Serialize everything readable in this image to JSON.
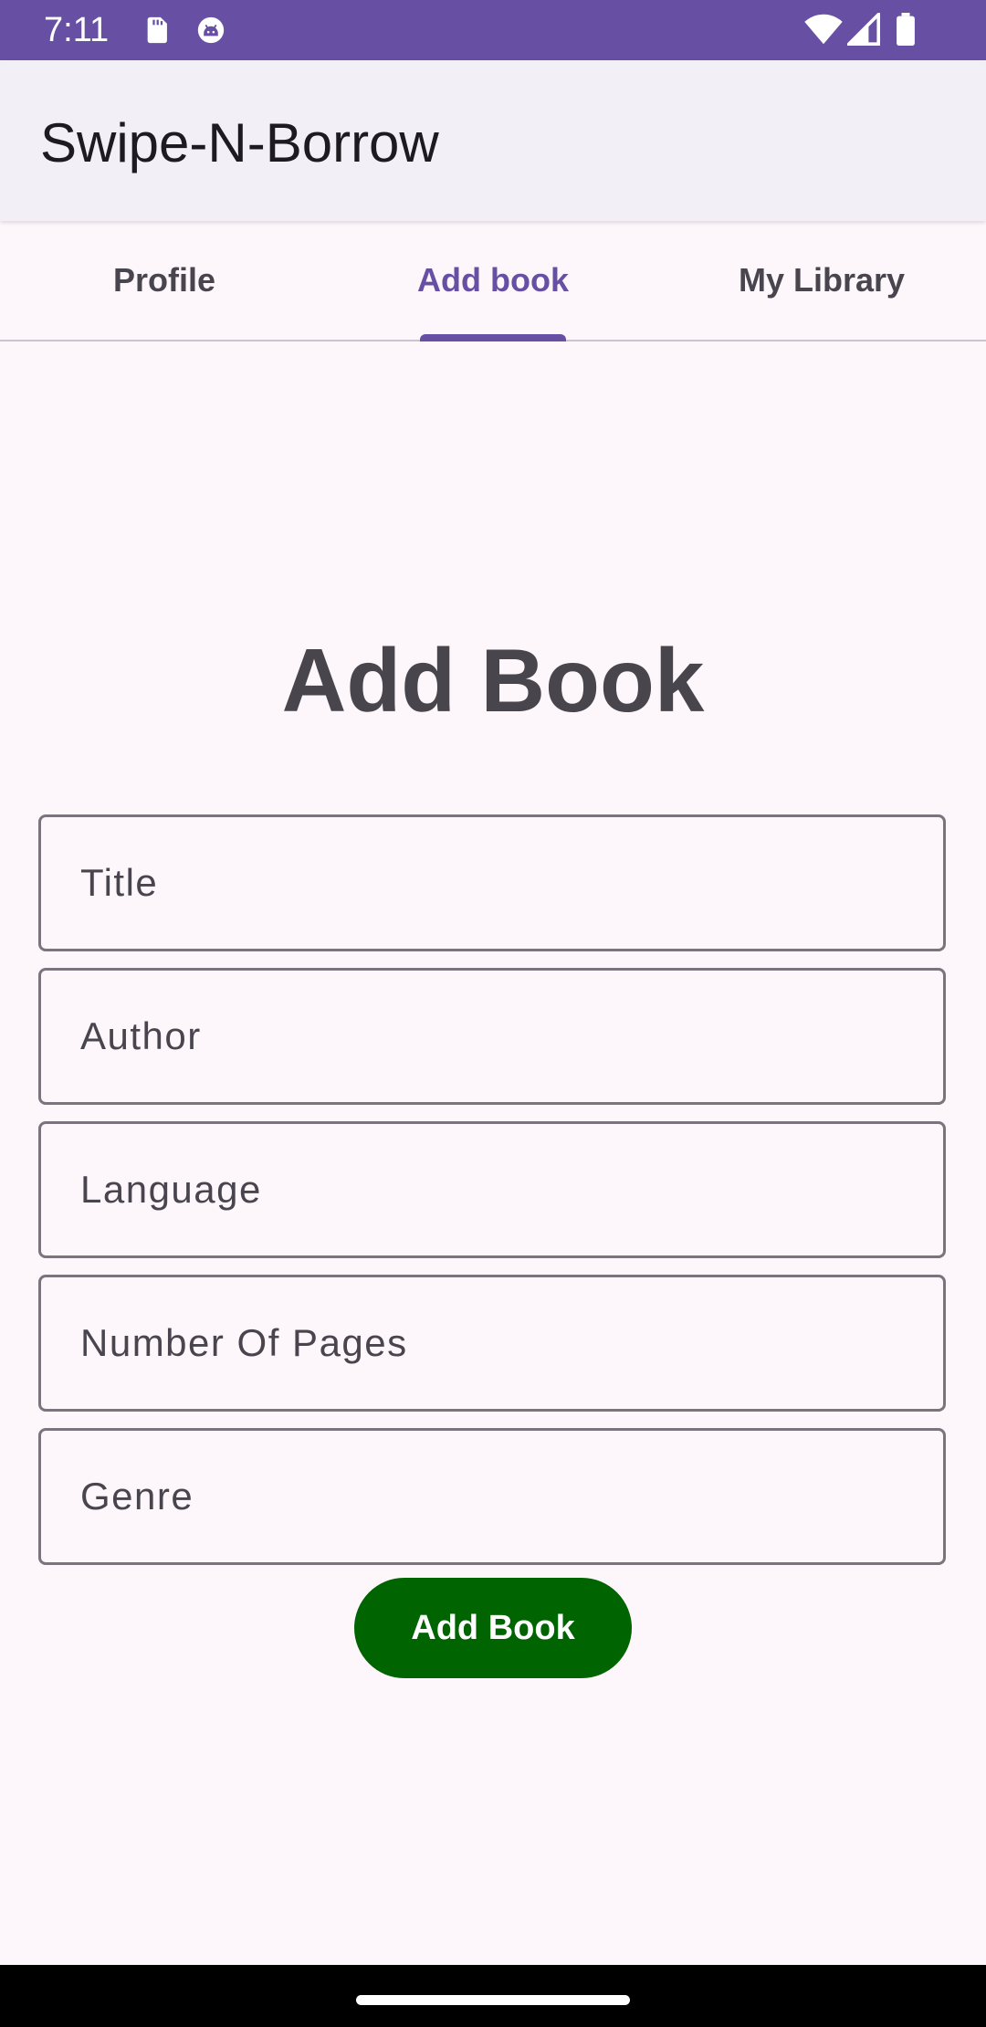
{
  "status_bar": {
    "time": "7:11",
    "left_icons": [
      "sd-card-icon",
      "android-debug-icon"
    ],
    "right_icons": [
      "wifi-icon",
      "signal-icon",
      "battery-icon"
    ],
    "color": "#6750A4"
  },
  "app_bar": {
    "title": "Swipe-N-Borrow"
  },
  "tabs": [
    {
      "label": "Profile",
      "active": false
    },
    {
      "label": "Add book",
      "active": true
    },
    {
      "label": "My Library",
      "active": false
    }
  ],
  "form": {
    "heading": "Add Book",
    "fields": {
      "title": {
        "placeholder": "Title",
        "value": ""
      },
      "author": {
        "placeholder": "Author",
        "value": ""
      },
      "language": {
        "placeholder": "Language",
        "value": ""
      },
      "pages": {
        "placeholder": "Number Of Pages",
        "value": ""
      },
      "genre": {
        "placeholder": "Genre",
        "value": ""
      }
    },
    "submit_label": "Add Book"
  },
  "colors": {
    "accent": "#6750A4",
    "button": "#006400",
    "background": "#FDF7FC"
  }
}
